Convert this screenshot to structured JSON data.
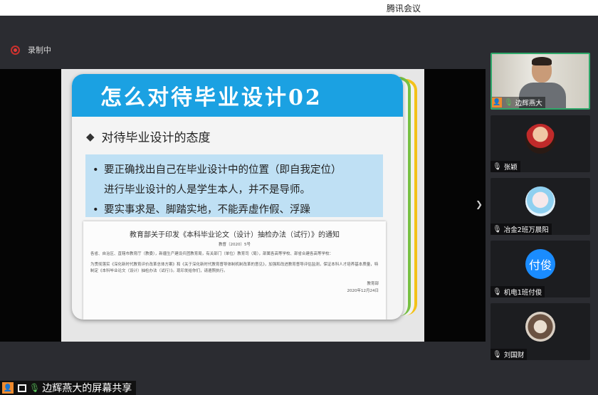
{
  "app": {
    "title": "腾讯会议"
  },
  "recording": {
    "label": "录制中"
  },
  "slide": {
    "title": "怎么对待毕业设计02",
    "attitude_heading": "对待毕业设计的态度",
    "bullets": [
      "要正确找出自己在毕业设计中的位置（即自我定位）",
      "进行毕业设计的人是学生本人，并不是导师。",
      "要实事求是、脚踏实地，不能弄虚作假、浮躁"
    ],
    "notice": {
      "title": "教育部关于印发《本科毕业论文（设计）抽检办法（试行）》的通知",
      "doc_no": "教督〔2020〕5号",
      "recipients": "各省、自治区、直辖市教育厅（教委），新疆生产建设兵团教育局，有关部门（单位）教育司（局），部属各高等学校、部省合建各高等学校：",
      "body": "为贯彻落实《深化新时代教育评价改革总体方案》和《关于深化新时代教育督导体制机制改革的意见》，加强和改进教育督导评估监测，保证本科人才培养基本质量，特制定《本科毕业论文（设计）抽检办法（试行）》。现印发给你们，请遵照执行。",
      "signer": "教育部",
      "date": "2020年12月24日"
    }
  },
  "share": {
    "label": "边辉燕大的屏幕共享"
  },
  "participants": [
    {
      "name": "边辉燕大",
      "avatar_type": "camera",
      "mic": "on",
      "host": true
    },
    {
      "name": "张颖",
      "avatar_type": "photo-red-hat",
      "mic": "off"
    },
    {
      "name": "冶金2班万晨阳",
      "avatar_type": "photo-anime",
      "mic": "off"
    },
    {
      "name": "机电1班付俊",
      "avatar_type": "text",
      "avatar_text": "付俊",
      "mic": "off",
      "avatar_color": "#1a8cff"
    },
    {
      "name": "刘国财",
      "avatar_type": "photo-cat",
      "mic": "off"
    }
  ],
  "colors": {
    "slide_header": "#1ba1e2",
    "bullet_bg": "#bfe0f4",
    "active_border": "#2fa86a",
    "host_badge": "#f08b2e",
    "record_red": "#e23b3b"
  },
  "icons": {
    "expand": "chevron-right-icon"
  }
}
